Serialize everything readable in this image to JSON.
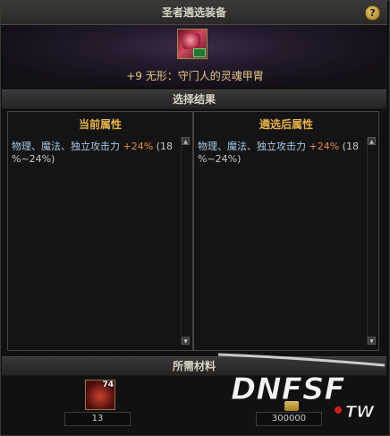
{
  "window": {
    "title": "圣者遴选装备",
    "help_label": "?"
  },
  "item": {
    "name": "+9 无形：守门人的灵魂甲胄"
  },
  "sections": {
    "result": "选择结果",
    "materials": "所需材料"
  },
  "panels": {
    "current": {
      "title": "当前属性",
      "stat_name": "物理、魔法、独立攻击力 ",
      "stat_value": "+24%",
      "stat_range_1": " (18",
      "stat_range_2": "%~24%)"
    },
    "after": {
      "title": "遴选后属性",
      "stat_name": "物理、魔法、独立攻击力 ",
      "stat_value": "+24%",
      "stat_range_1": " (18",
      "stat_range_2": "%~24%)"
    }
  },
  "materials": {
    "item_level": "74",
    "item_count": "13",
    "gold_cost": "300000"
  },
  "watermark": {
    "text": "DNFSF.TW"
  },
  "colors": {
    "accent_gold": "#e8b446",
    "stat_blue": "#a7c9e3",
    "pct_orange": "#e38c3a"
  }
}
